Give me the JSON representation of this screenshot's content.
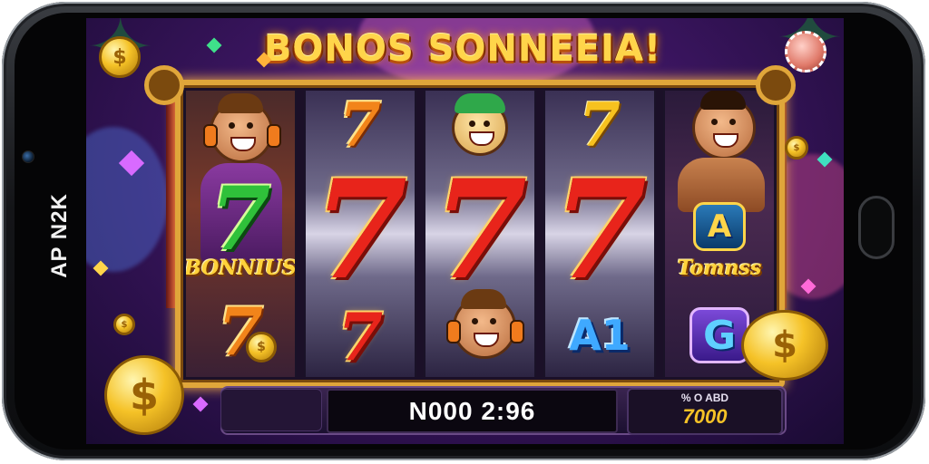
{
  "device": {
    "side_label": "AP N2K"
  },
  "game": {
    "title": "BONOS SONNEEIA!",
    "reels": [
      {
        "id": 1,
        "symbols": [
          "character",
          "7 BONNIUS",
          "7"
        ]
      },
      {
        "id": 2,
        "symbols": [
          "7",
          "7",
          "7"
        ]
      },
      {
        "id": 3,
        "symbols": [
          "jester",
          "7",
          "character"
        ]
      },
      {
        "id": 4,
        "symbols": [
          "7",
          "7",
          "A1"
        ]
      },
      {
        "id": 5,
        "symbols": [
          "character",
          "A TOMNSS",
          "G"
        ]
      }
    ],
    "symbol_labels": {
      "bonus_left": "BONNIUS",
      "bonus_right": "Tomnss",
      "seven": "7",
      "a1": "A1",
      "g": "G",
      "chest_a": "A"
    },
    "win_display": "N000 2:96",
    "credit": {
      "label": "% O ABD",
      "value": "7000"
    }
  },
  "colors": {
    "title_gold": "#ffd54a",
    "frame_gold": "#e0a63a",
    "seven_red": "#e8241b",
    "seven_green": "#2fc13a",
    "background_purple": "#3b1560"
  },
  "icons": [
    "coin-icon",
    "casino-chip-icon",
    "gem-icon",
    "home-button-icon",
    "camera-icon"
  ]
}
